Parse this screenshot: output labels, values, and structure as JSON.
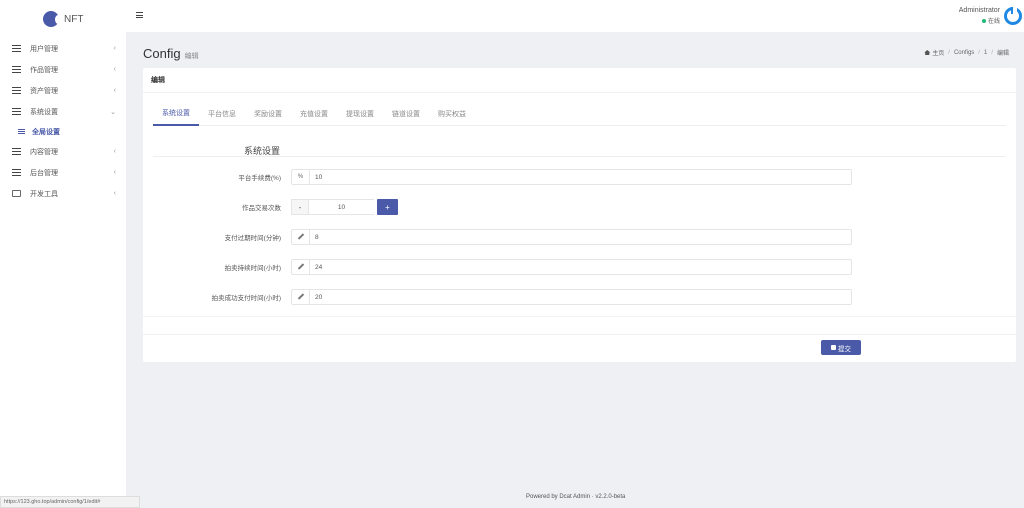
{
  "logo": {
    "text": "NFT"
  },
  "sidebar": {
    "items": [
      {
        "label": "用户管理",
        "chev": "‹"
      },
      {
        "label": "作品管理",
        "chev": "‹"
      },
      {
        "label": "资产管理",
        "chev": "‹"
      },
      {
        "label": "系统设置",
        "chev": "⌄"
      },
      {
        "label": "内容管理",
        "chev": "‹"
      },
      {
        "label": "后台管理",
        "chev": "‹"
      },
      {
        "label": "开发工具",
        "chev": "‹"
      }
    ],
    "subitem": {
      "label": "全局设置"
    }
  },
  "header": {
    "user_name": "Administrator",
    "user_status": "在线"
  },
  "page": {
    "title": "Config",
    "subtitle": "编辑"
  },
  "breadcrumb": {
    "home": "主页",
    "items": [
      "Configs",
      "1",
      "编辑"
    ]
  },
  "card": {
    "header": "编辑",
    "tabs": [
      "系统设置",
      "平台信息",
      "奖励设置",
      "充值设置",
      "提现设置",
      "链道设置",
      "购买权益"
    ],
    "active_tab_index": 0,
    "section_title": "系统设置",
    "fields": {
      "fee": {
        "label": "平台手续费(%)",
        "addon": "%",
        "value": "10"
      },
      "trade_count": {
        "label": "作品交易次数",
        "value": "10",
        "minus": "-",
        "plus": "+"
      },
      "pay_expire": {
        "label": "支付过期时间(分钟)",
        "value": "8"
      },
      "auction_duration": {
        "label": "拍卖持续时间(小时)",
        "value": "24"
      },
      "auction_pay": {
        "label": "拍卖成功支付时间(小时)",
        "value": "20"
      }
    },
    "submit_label": "提交"
  },
  "footer": {
    "powered": "Powered by Dcat Admin · v2.2.0-beta"
  },
  "statusbar": {
    "url": "https://123.gho.top/admin/config/1/edit#"
  }
}
